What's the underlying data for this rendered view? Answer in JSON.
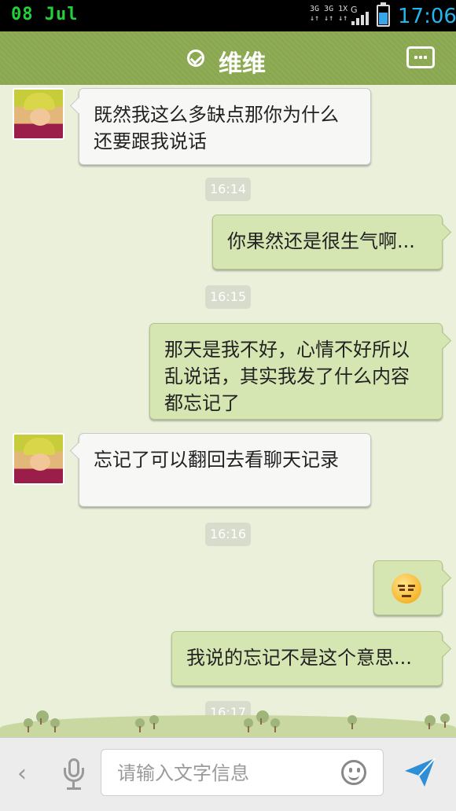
{
  "status_bar": {
    "date": "08  Jul",
    "network_top": "3G 3G 1X",
    "network_bottom": "↓↑ ↓↑ ↓↑",
    "net_type": "G",
    "time": "17:06"
  },
  "header": {
    "title": "维维",
    "status_icon": "check-circle-icon",
    "menu_icon": "more-dots-icon",
    "bg_color": "#8aa850"
  },
  "messages": [
    {
      "side": "left",
      "text": "既然我这么多缺点那你为什么还要跟我说话"
    },
    {
      "time": "16:14"
    },
    {
      "side": "right",
      "text": "你果然还是很生气啊..."
    },
    {
      "time": "16:15"
    },
    {
      "side": "right",
      "text": "那天是我不好，心情不好所以乱说话，其实我发了什么内容都忘记了"
    },
    {
      "side": "left",
      "text": "忘记了可以翻回去看聊天记录"
    },
    {
      "time": "16:16"
    },
    {
      "side": "right",
      "emoji": "annoyed-face-emoji"
    },
    {
      "side": "right",
      "text": "我说的忘记不是这个意思..."
    },
    {
      "time": "16:17"
    }
  ],
  "input_bar": {
    "placeholder": "请输入文字信息",
    "value": "",
    "left_icon": "back-arrow-icon",
    "voice_icon": "microphone-icon",
    "emoji_icon": "smiley-icon",
    "send_icon": "send-plane-icon"
  },
  "colors": {
    "chat_bg": "#eaf0da",
    "own_bubble": "#d6e6b2",
    "other_bubble": "#f7f7f6",
    "time_accent": "#22b6ec",
    "date_accent": "#22d03a"
  }
}
